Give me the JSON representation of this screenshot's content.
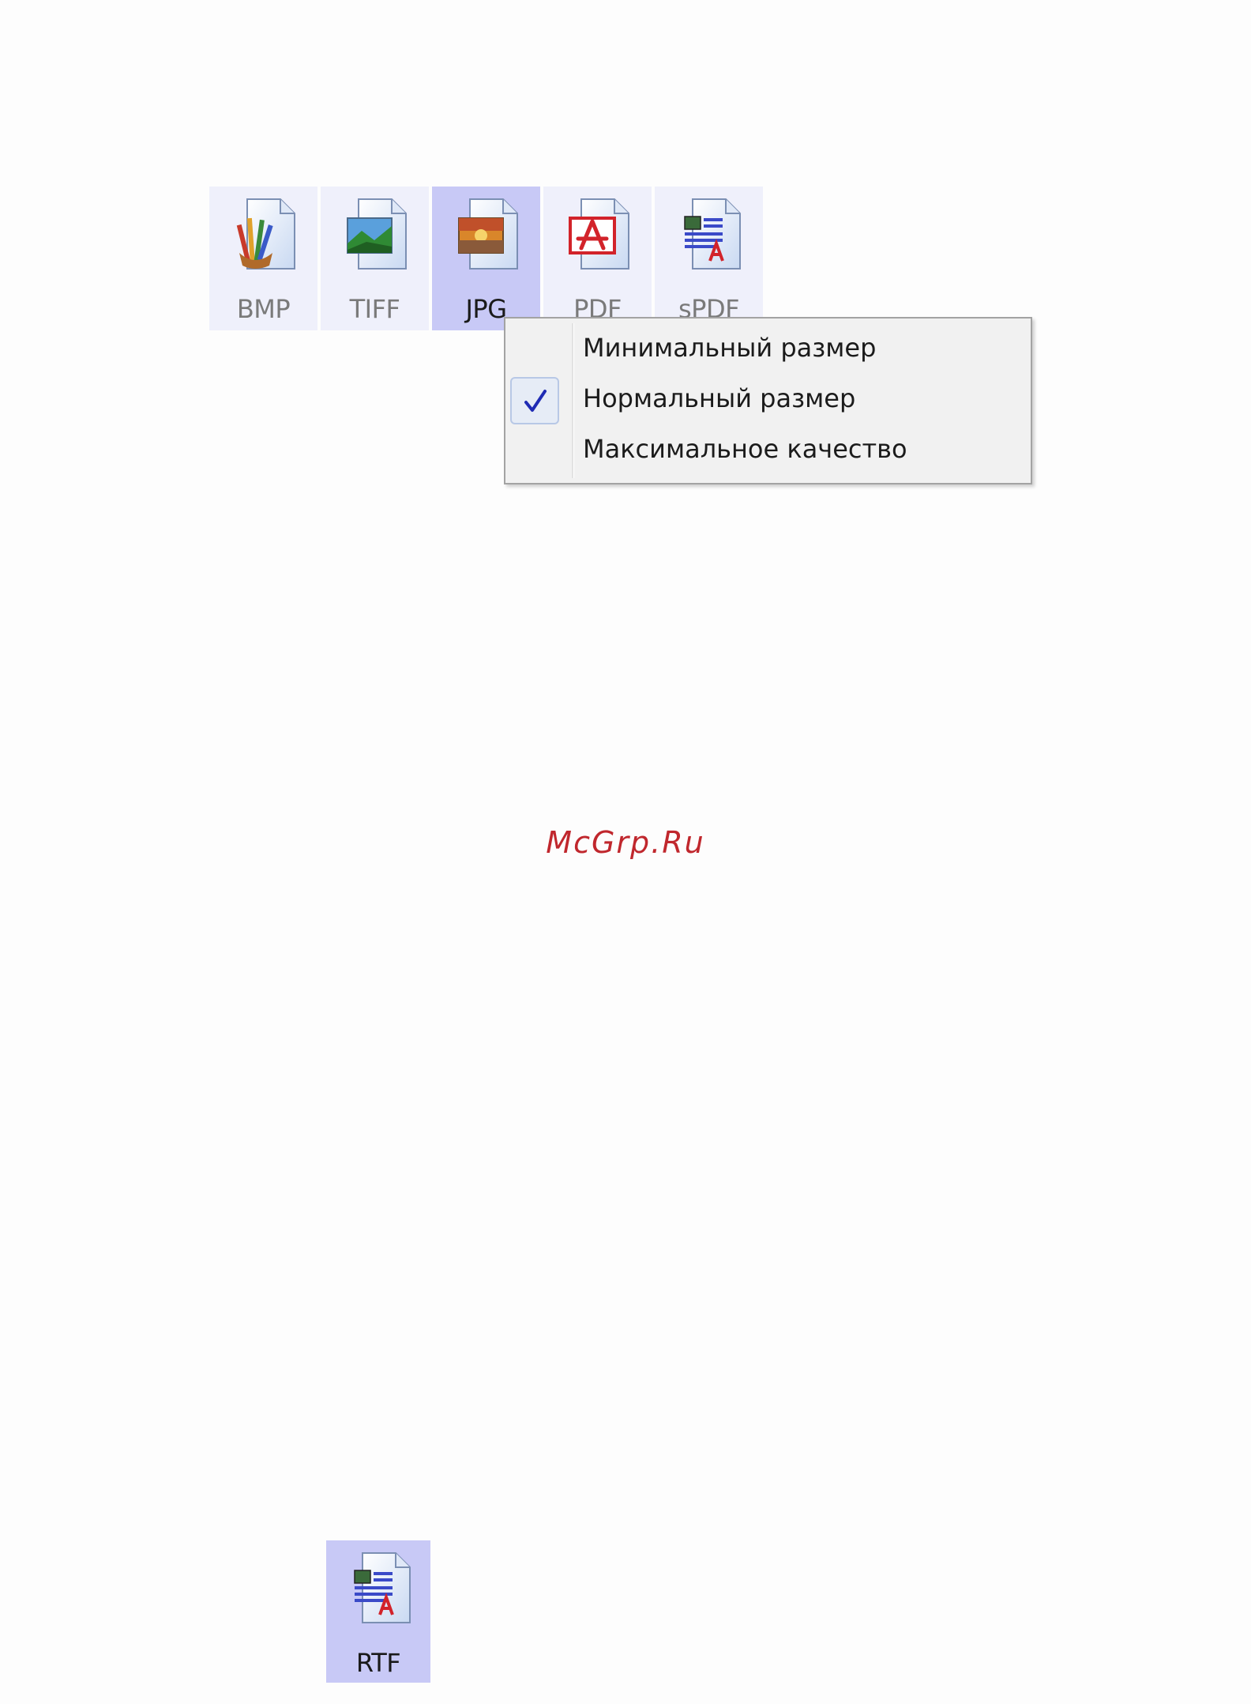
{
  "format_bar": {
    "buttons": [
      {
        "label": "BMP",
        "icon": "bmp-file-icon"
      },
      {
        "label": "TIFF",
        "icon": "tiff-file-icon"
      },
      {
        "label": "JPG",
        "icon": "jpg-file-icon",
        "selected": true
      },
      {
        "label": "PDF",
        "icon": "pdf-file-icon"
      },
      {
        "label": "sPDF",
        "icon": "spdf-file-icon"
      }
    ]
  },
  "context_menu": {
    "items": [
      {
        "label": "Минимальный размер",
        "checked": false
      },
      {
        "label": "Нормальный размер",
        "checked": true
      },
      {
        "label": "Максимальное качество",
        "checked": false
      }
    ]
  },
  "watermark": "McGrp.Ru",
  "bottom_button": {
    "label": "RTF",
    "icon": "rtf-file-icon",
    "selected": true
  },
  "colors": {
    "button_bg": "#eff0fb",
    "button_selected_bg": "#c8c9f6",
    "menu_bg": "#f1f1f1",
    "check_mark": "#1f2bb4",
    "watermark": "#c0272d"
  }
}
